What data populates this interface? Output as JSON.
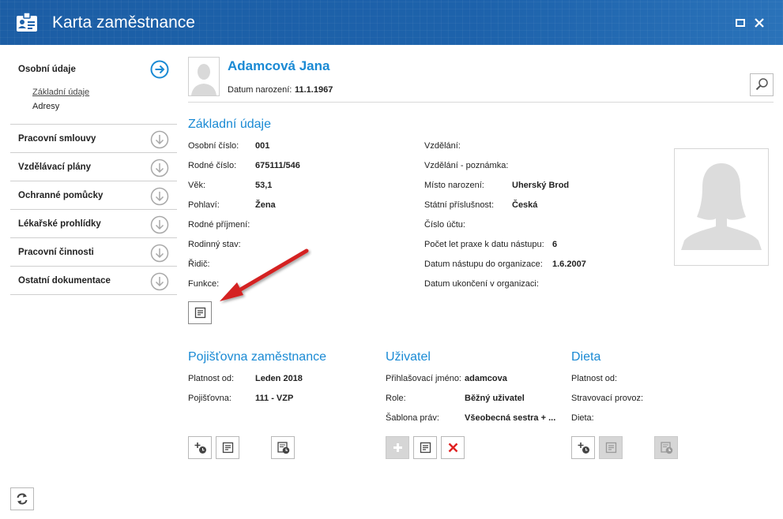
{
  "window": {
    "title": "Karta zaměstnance",
    "icon": "id-card-icon"
  },
  "sidebar": {
    "items": [
      {
        "label": "Osobní údaje",
        "icon": "arrow-right-circle-icon",
        "active": true,
        "subitems": [
          "Základní údaje",
          "Adresy"
        ]
      },
      {
        "label": "Pracovní smlouvy",
        "icon": "arrow-down-circle-icon"
      },
      {
        "label": "Vzdělávací plány",
        "icon": "arrow-down-circle-icon"
      },
      {
        "label": "Ochranné pomůcky",
        "icon": "arrow-down-circle-icon"
      },
      {
        "label": "Lékařské prohlídky",
        "icon": "arrow-down-circle-icon"
      },
      {
        "label": "Pracovní činnosti",
        "icon": "arrow-down-circle-icon"
      },
      {
        "label": "Ostatní dokumentace",
        "icon": "arrow-down-circle-icon"
      }
    ]
  },
  "person": {
    "name": "Adamcová Jana",
    "dob_label": "Datum narození:",
    "dob_value": "11.1.1967"
  },
  "basic": {
    "title": "Základní údaje",
    "left": [
      {
        "label": "Osobní číslo:",
        "value": "001"
      },
      {
        "label": "Rodné číslo:",
        "value": "675111/546"
      },
      {
        "label": "Věk:",
        "value": "53,1"
      },
      {
        "label": "Pohlaví:",
        "value": "Žena"
      },
      {
        "label": "Rodné příjmení:",
        "value": ""
      },
      {
        "label": "Rodinný stav:",
        "value": ""
      },
      {
        "label": "Řidič:",
        "value": ""
      },
      {
        "label": "Funkce:",
        "value": ""
      }
    ],
    "right": [
      {
        "label": "Vzdělání:",
        "value": ""
      },
      {
        "label": "Vzdělání - poznámka:",
        "value": ""
      },
      {
        "label": "Místo narození:",
        "value": "Uherský Brod"
      },
      {
        "label": "Státní příslušnost:",
        "value": "Česká"
      },
      {
        "label": "Číslo účtu:",
        "value": ""
      },
      {
        "label": "Počet let praxe k datu nástupu:",
        "value": "6"
      },
      {
        "label": "Datum nástupu do organizace:",
        "value": "1.6.2007"
      },
      {
        "label": "Datum ukončení v organizaci:",
        "value": ""
      }
    ]
  },
  "insurance": {
    "title": "Pojišťovna zaměstnance",
    "rows": [
      {
        "label": "Platnost od:",
        "value": "Leden 2018"
      },
      {
        "label": "Pojišťovna:",
        "value": "111 - VZP"
      }
    ]
  },
  "user": {
    "title": "Uživatel",
    "rows": [
      {
        "label": "Přihlašovací jméno:",
        "value": "adamcova"
      },
      {
        "label": "Role:",
        "value": "Běžný uživatel"
      },
      {
        "label": "Šablona práv:",
        "value": "Všeobecná sestra + ..."
      }
    ]
  },
  "diet": {
    "title": "Dieta",
    "rows": [
      {
        "label": "Platnost od:",
        "value": ""
      },
      {
        "label": "Stravovací provoz:",
        "value": ""
      },
      {
        "label": "Dieta:",
        "value": ""
      }
    ]
  },
  "colors": {
    "titlebar": "#1d62ab",
    "accent": "#1a8ad4",
    "annotation_arrow": "#d42020"
  }
}
